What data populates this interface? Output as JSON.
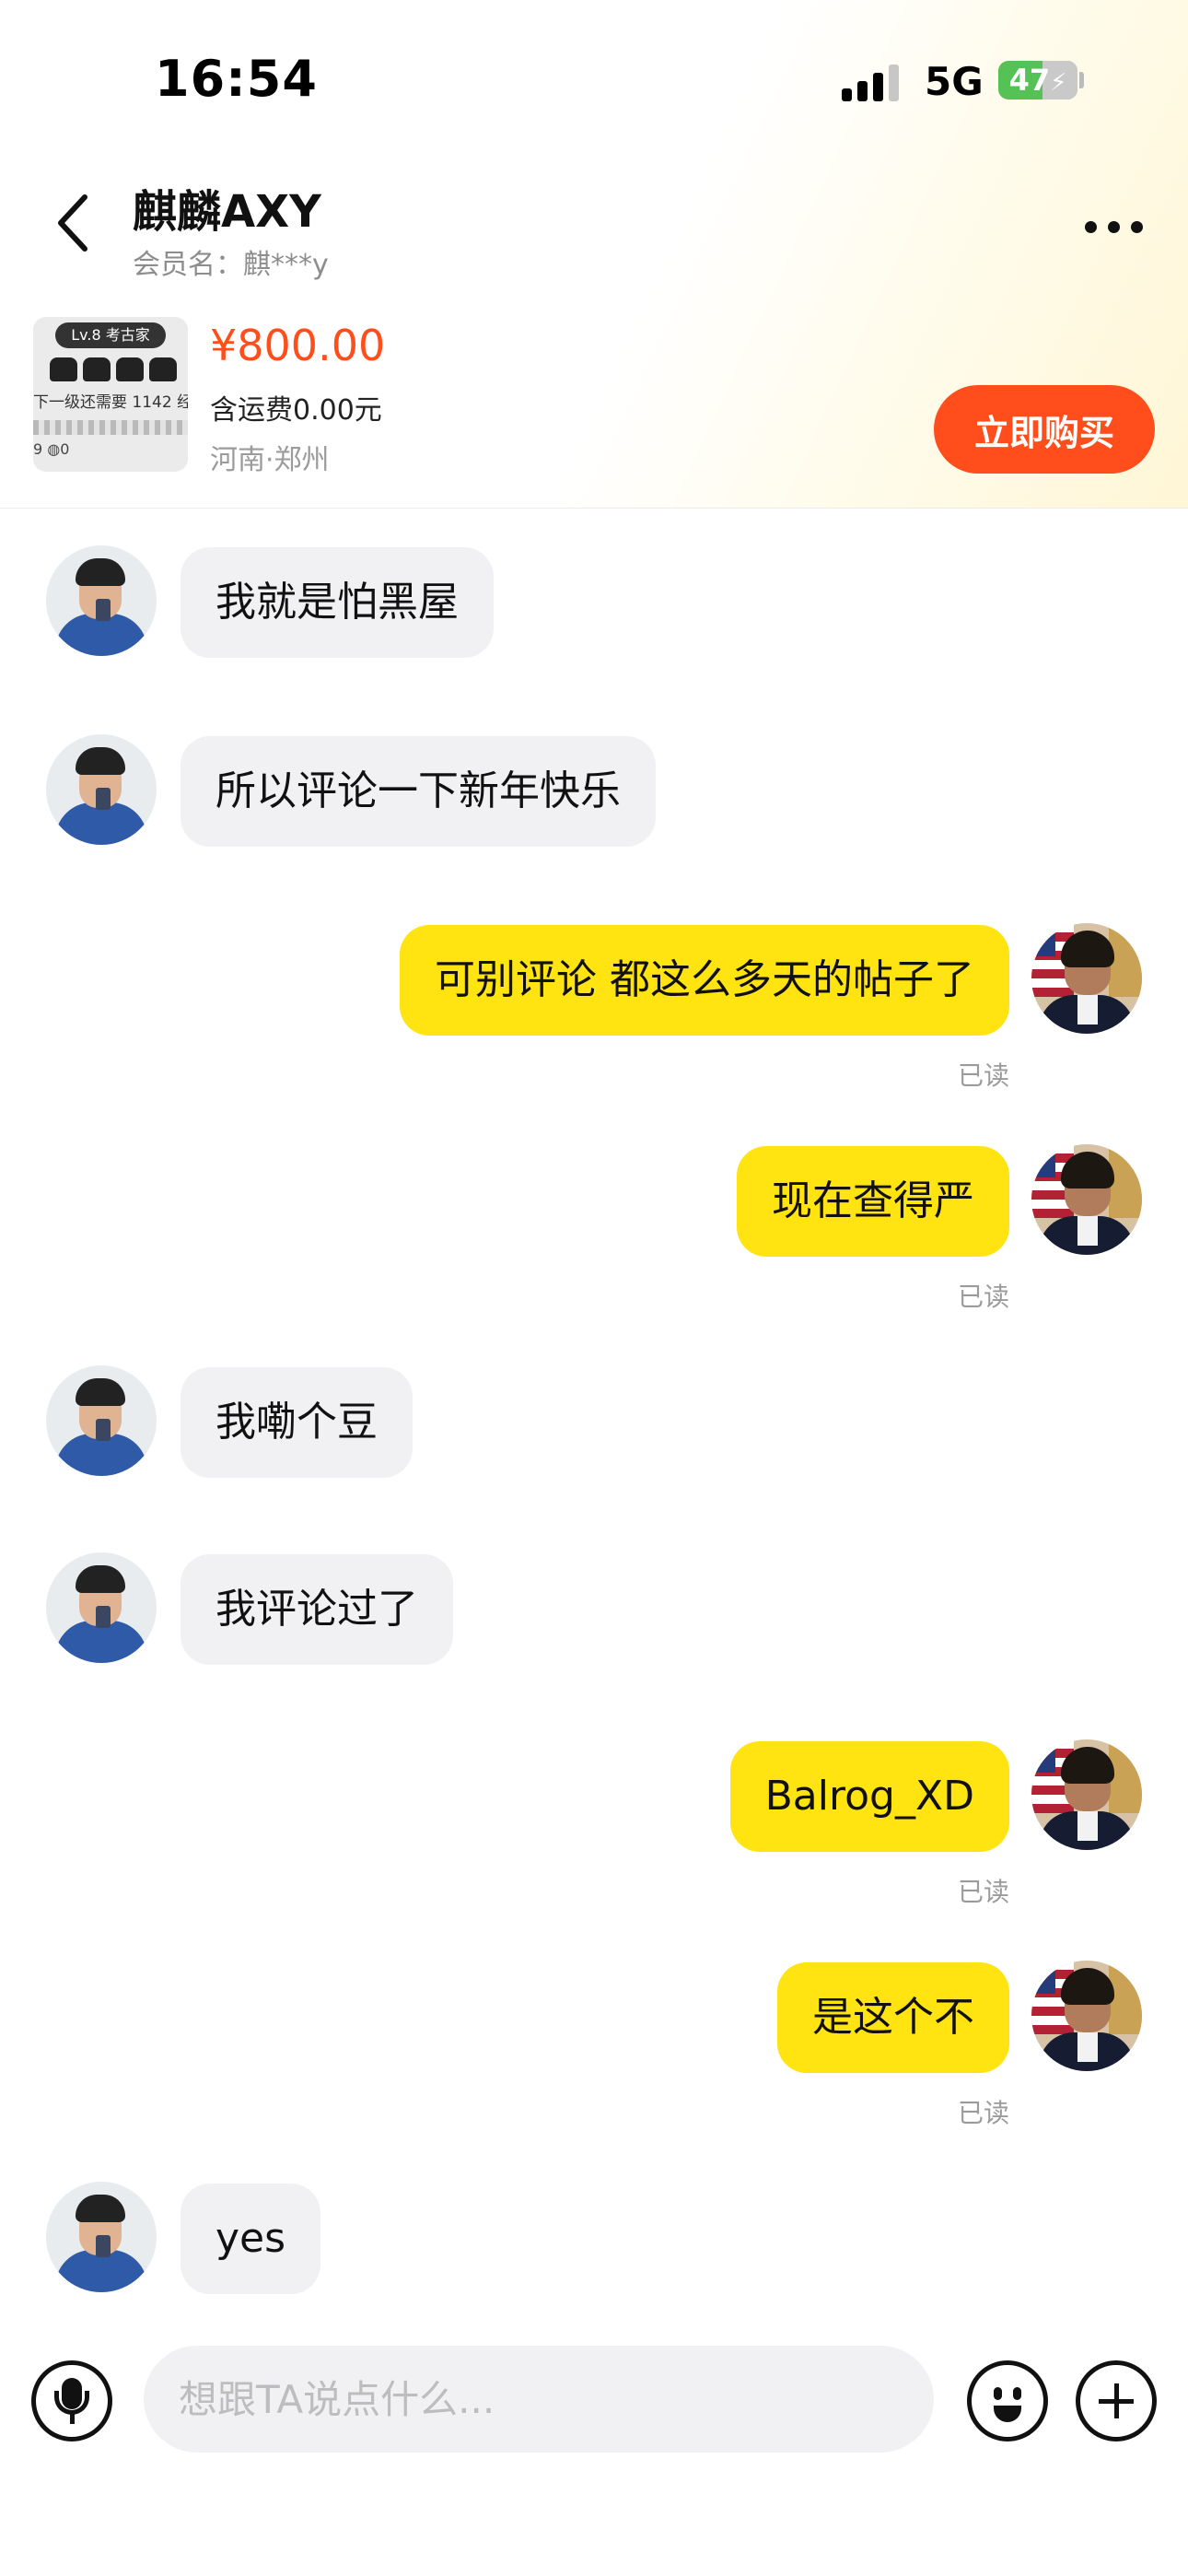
{
  "status_bar": {
    "time": "16:54",
    "network": "5G",
    "battery": "47"
  },
  "header": {
    "contact_name": "麒麟AXY",
    "member_label": "会员名：麒***y"
  },
  "product": {
    "thumb_badge": "Lv.8 考古家",
    "thumb_text": "下一级还需要 1142 经",
    "thumb_footer": "9  ◍0",
    "price": "¥800.00",
    "shipping": "含运费0.00元",
    "location": "河南·郑州",
    "buy_label": "立即购买"
  },
  "messages": [
    {
      "direction": "in",
      "text": "我就是怕黑屋"
    },
    {
      "direction": "in",
      "text": "所以评论一下新年快乐"
    },
    {
      "direction": "out",
      "text": "可别评论 都这么多天的帖子了",
      "status": "已读"
    },
    {
      "direction": "out",
      "text": "现在查得严",
      "status": "已读"
    },
    {
      "direction": "in",
      "text": "我嘞个豆"
    },
    {
      "direction": "in",
      "text": "我评论过了"
    },
    {
      "direction": "out",
      "text": "Balrog_XD",
      "status": "已读"
    },
    {
      "direction": "out",
      "text": "是这个不",
      "status": "已读"
    },
    {
      "direction": "in",
      "text": "yes"
    }
  ],
  "input_bar": {
    "placeholder": "想跟TA说点什么...",
    "value": ""
  },
  "colors": {
    "accent_orange": "#ff4d1c",
    "outgoing_bubble": "#ffe411",
    "incoming_bubble": "#f1f1f3",
    "battery_green": "#55c255"
  },
  "icons": {
    "back": "chevron-left-icon",
    "more": "more-horizontal-icon",
    "voice": "microphone-icon",
    "emoji": "smiley-icon",
    "add": "plus-icon"
  }
}
